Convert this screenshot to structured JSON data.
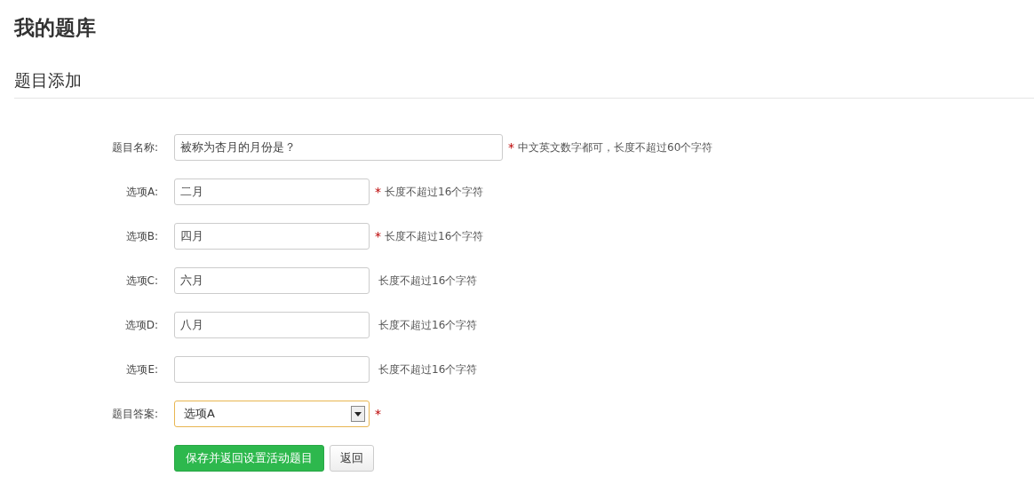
{
  "page_title": "我的题库",
  "section_title": "题目添加",
  "fields": [
    {
      "kind": "text",
      "label": "题目名称:",
      "value": "被称为杏月的月份是？",
      "wide": true,
      "required_mark": "*",
      "hint": "中文英文数字都可，长度不超过60个字符"
    },
    {
      "kind": "text",
      "label": "选项A:",
      "value": "二月",
      "wide": false,
      "required_mark": "*",
      "hint": "长度不超过16个字符"
    },
    {
      "kind": "text",
      "label": "选项B:",
      "value": "四月",
      "wide": false,
      "required_mark": "*",
      "hint": "长度不超过16个字符"
    },
    {
      "kind": "text",
      "label": "选项C:",
      "value": "六月",
      "wide": false,
      "hint": "长度不超过16个字符"
    },
    {
      "kind": "text",
      "label": "选项D:",
      "value": "八月",
      "wide": false,
      "hint": "长度不超过16个字符"
    },
    {
      "kind": "text",
      "label": "选项E:",
      "wide": false,
      "hint": "长度不超过16个字符"
    },
    {
      "kind": "select",
      "label": "题目答案:",
      "value": "选项A",
      "required_mark": "*"
    }
  ],
  "buttons": [
    {
      "kind": "primary",
      "label": "保存并返回设置活动题目"
    },
    {
      "kind": "default",
      "label": "返回"
    }
  ]
}
